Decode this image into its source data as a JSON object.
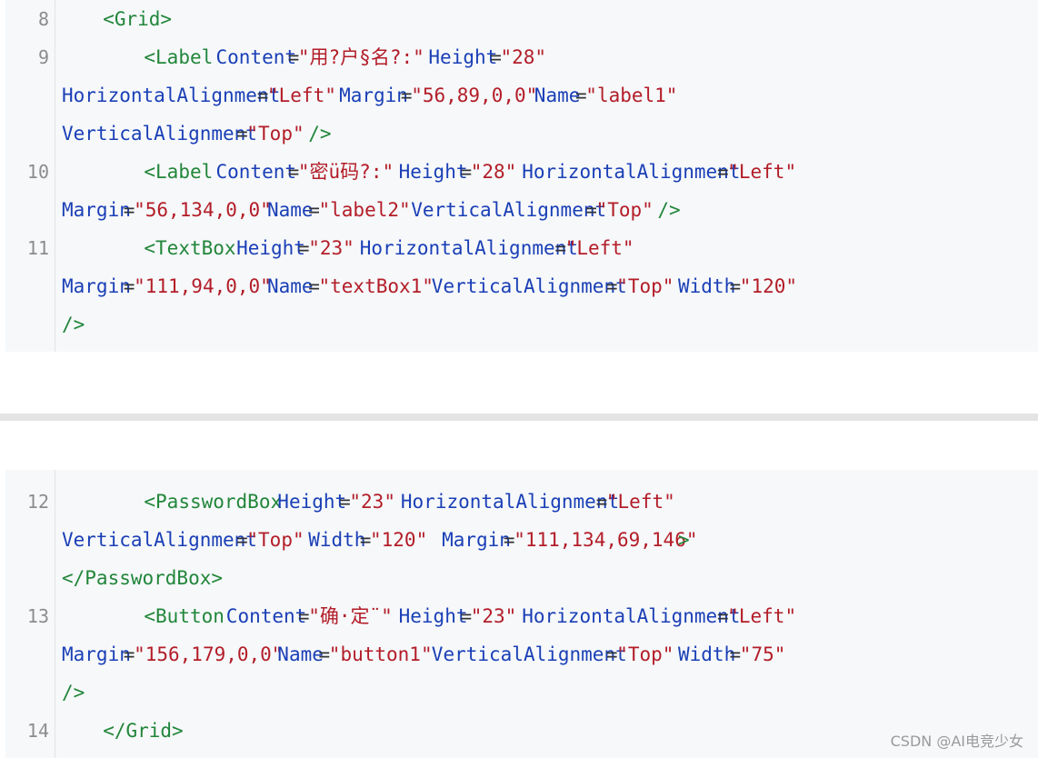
{
  "lines": [
    {
      "num": "8",
      "parts": [
        {
          "t": "    ",
          "c": "pun"
        },
        {
          "t": "<Grid>",
          "c": "tag"
        }
      ]
    },
    {
      "num": "9",
      "parts": [
        {
          "t": "        ",
          "c": "pun"
        },
        {
          "t": "<Label",
          "c": "tag"
        },
        {
          "t": " ",
          "c": "pun"
        },
        {
          "t": "Content",
          "c": "attr"
        },
        {
          "t": "=",
          "c": "pun"
        },
        {
          "t": "\"用?户§名?:\"",
          "c": "str"
        },
        {
          "t": " ",
          "c": "pun"
        },
        {
          "t": "Height",
          "c": "attr"
        },
        {
          "t": "=",
          "c": "pun"
        },
        {
          "t": "\"28\"",
          "c": "str"
        }
      ]
    },
    {
      "num": "",
      "parts": [
        {
          "t": "HorizontalAlignment",
          "c": "attr"
        },
        {
          "t": "=",
          "c": "pun"
        },
        {
          "t": "\"Left\"",
          "c": "str"
        },
        {
          "t": " ",
          "c": "pun"
        },
        {
          "t": "Margin",
          "c": "attr"
        },
        {
          "t": "=",
          "c": "pun"
        },
        {
          "t": "\"56,89,0,0\"",
          "c": "str"
        },
        {
          "t": " ",
          "c": "pun"
        },
        {
          "t": "Name",
          "c": "attr"
        },
        {
          "t": "=",
          "c": "pun"
        },
        {
          "t": "\"label1\"",
          "c": "str"
        }
      ]
    },
    {
      "num": "",
      "parts": [
        {
          "t": "VerticalAlignment",
          "c": "attr"
        },
        {
          "t": "=",
          "c": "pun"
        },
        {
          "t": "\"Top\"",
          "c": "str"
        },
        {
          "t": " ",
          "c": "pun"
        },
        {
          "t": "/>",
          "c": "tag"
        }
      ]
    },
    {
      "num": "10",
      "parts": [
        {
          "t": "        ",
          "c": "pun"
        },
        {
          "t": "<Label",
          "c": "tag"
        },
        {
          "t": " ",
          "c": "pun"
        },
        {
          "t": "Content",
          "c": "attr"
        },
        {
          "t": "=",
          "c": "pun"
        },
        {
          "t": "\"密ü码?:\"",
          "c": "str"
        },
        {
          "t": " ",
          "c": "pun"
        },
        {
          "t": "Height",
          "c": "attr"
        },
        {
          "t": "=",
          "c": "pun"
        },
        {
          "t": "\"28\"",
          "c": "str"
        },
        {
          "t": " ",
          "c": "pun"
        },
        {
          "t": "HorizontalAlignment",
          "c": "attr"
        },
        {
          "t": "=",
          "c": "pun"
        },
        {
          "t": "\"Left\"",
          "c": "str"
        }
      ]
    },
    {
      "num": "",
      "parts": [
        {
          "t": "Margin",
          "c": "attr"
        },
        {
          "t": "=",
          "c": "pun"
        },
        {
          "t": "\"56,134,0,0\"",
          "c": "str"
        },
        {
          "t": " ",
          "c": "pun"
        },
        {
          "t": "Name",
          "c": "attr"
        },
        {
          "t": "=",
          "c": "pun"
        },
        {
          "t": "\"label2\"",
          "c": "str"
        },
        {
          "t": " ",
          "c": "pun"
        },
        {
          "t": "VerticalAlignment",
          "c": "attr"
        },
        {
          "t": "=",
          "c": "pun"
        },
        {
          "t": "\"Top\"",
          "c": "str"
        },
        {
          "t": " ",
          "c": "pun"
        },
        {
          "t": "/>",
          "c": "tag"
        }
      ]
    },
    {
      "num": "11",
      "parts": [
        {
          "t": "        ",
          "c": "pun"
        },
        {
          "t": "<TextBox",
          "c": "tag"
        },
        {
          "t": " ",
          "c": "pun"
        },
        {
          "t": "Height",
          "c": "attr"
        },
        {
          "t": "=",
          "c": "pun"
        },
        {
          "t": "\"23\"",
          "c": "str"
        },
        {
          "t": " ",
          "c": "pun"
        },
        {
          "t": "HorizontalAlignment",
          "c": "attr"
        },
        {
          "t": "=",
          "c": "pun"
        },
        {
          "t": "\"Left\"",
          "c": "str"
        }
      ]
    },
    {
      "num": "",
      "parts": [
        {
          "t": "Margin",
          "c": "attr"
        },
        {
          "t": "=",
          "c": "pun"
        },
        {
          "t": "\"111,94,0,0\"",
          "c": "str"
        },
        {
          "t": " ",
          "c": "pun"
        },
        {
          "t": "Name",
          "c": "attr"
        },
        {
          "t": "=",
          "c": "pun"
        },
        {
          "t": "\"textBox1\"",
          "c": "str"
        },
        {
          "t": " ",
          "c": "pun"
        },
        {
          "t": "VerticalAlignment",
          "c": "attr"
        },
        {
          "t": "=",
          "c": "pun"
        },
        {
          "t": "\"Top\"",
          "c": "str"
        },
        {
          "t": " ",
          "c": "pun"
        },
        {
          "t": "Width",
          "c": "attr"
        },
        {
          "t": "=",
          "c": "pun"
        },
        {
          "t": "\"120\"",
          "c": "str"
        }
      ]
    },
    {
      "num": "",
      "parts": [
        {
          "t": "/>",
          "c": "tag"
        }
      ]
    },
    {
      "num": "12",
      "parts": [
        {
          "t": "        ",
          "c": "pun"
        },
        {
          "t": "<PasswordBox",
          "c": "tag"
        },
        {
          "t": " ",
          "c": "pun"
        },
        {
          "t": "Height",
          "c": "attr"
        },
        {
          "t": "=",
          "c": "pun"
        },
        {
          "t": "\"23\"",
          "c": "str"
        },
        {
          "t": " ",
          "c": "pun"
        },
        {
          "t": "HorizontalAlignment",
          "c": "attr"
        },
        {
          "t": "=",
          "c": "pun"
        },
        {
          "t": "\"Left\"",
          "c": "str"
        }
      ]
    },
    {
      "num": "",
      "parts": [
        {
          "t": "VerticalAlignment",
          "c": "attr"
        },
        {
          "t": "=",
          "c": "pun"
        },
        {
          "t": "\"Top\"",
          "c": "str"
        },
        {
          "t": " ",
          "c": "pun"
        },
        {
          "t": "Width",
          "c": "attr"
        },
        {
          "t": "=",
          "c": "pun"
        },
        {
          "t": "\"120\"",
          "c": "str"
        },
        {
          "t": "  ",
          "c": "pun"
        },
        {
          "t": "Margin",
          "c": "attr"
        },
        {
          "t": "=",
          "c": "pun"
        },
        {
          "t": "\"111,134,69,146\"",
          "c": "str"
        },
        {
          "t": ">",
          "c": "tag"
        }
      ]
    },
    {
      "num": "",
      "parts": [
        {
          "t": "</PasswordBox>",
          "c": "tag"
        }
      ]
    },
    {
      "num": "13",
      "parts": [
        {
          "t": "        ",
          "c": "pun"
        },
        {
          "t": "<Button",
          "c": "tag"
        },
        {
          "t": " ",
          "c": "pun"
        },
        {
          "t": "Content",
          "c": "attr"
        },
        {
          "t": "=",
          "c": "pun"
        },
        {
          "t": "\"确·定¨\"",
          "c": "str"
        },
        {
          "t": " ",
          "c": "pun"
        },
        {
          "t": "Height",
          "c": "attr"
        },
        {
          "t": "=",
          "c": "pun"
        },
        {
          "t": "\"23\"",
          "c": "str"
        },
        {
          "t": " ",
          "c": "pun"
        },
        {
          "t": "HorizontalAlignment",
          "c": "attr"
        },
        {
          "t": "=",
          "c": "pun"
        },
        {
          "t": "\"Left\"",
          "c": "str"
        }
      ]
    },
    {
      "num": "",
      "parts": [
        {
          "t": "Margin",
          "c": "attr"
        },
        {
          "t": "=",
          "c": "pun"
        },
        {
          "t": "\"156,179,0,0\"",
          "c": "str"
        },
        {
          "t": " ",
          "c": "pun"
        },
        {
          "t": "Name",
          "c": "attr"
        },
        {
          "t": "=",
          "c": "pun"
        },
        {
          "t": "\"button1\"",
          "c": "str"
        },
        {
          "t": " ",
          "c": "pun"
        },
        {
          "t": "VerticalAlignment",
          "c": "attr"
        },
        {
          "t": "=",
          "c": "pun"
        },
        {
          "t": "\"Top\"",
          "c": "str"
        },
        {
          "t": " ",
          "c": "pun"
        },
        {
          "t": "Width",
          "c": "attr"
        },
        {
          "t": "=",
          "c": "pun"
        },
        {
          "t": "\"75\"",
          "c": "str"
        }
      ]
    },
    {
      "num": "",
      "parts": [
        {
          "t": "/>",
          "c": "tag"
        }
      ]
    },
    {
      "num": "14",
      "parts": [
        {
          "t": "    ",
          "c": "pun"
        },
        {
          "t": "</Grid>",
          "c": "tag"
        }
      ]
    }
  ],
  "watermark": "CSDN @AI电竞少女",
  "colors": {
    "tag": "#22863a",
    "attribute": "#1a3fb6",
    "string": "#b31d28",
    "line_number": "#8c8c8c",
    "code_background": "#f6f8fa"
  }
}
